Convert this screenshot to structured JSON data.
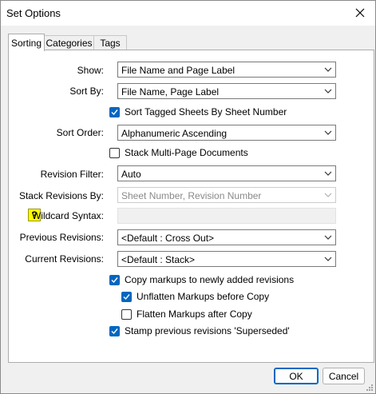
{
  "window": {
    "title": "Set Options"
  },
  "tabs": [
    {
      "label": "Sorting"
    },
    {
      "label": "Categories"
    },
    {
      "label": "Tags"
    }
  ],
  "fields": {
    "show": {
      "label": "Show:",
      "value": "File Name and Page Label"
    },
    "sort_by": {
      "label": "Sort By:",
      "value": "File Name, Page Label"
    },
    "sort_tagged": {
      "label": "Sort Tagged Sheets By Sheet Number",
      "checked": true
    },
    "sort_order": {
      "label": "Sort Order:",
      "value": "Alphanumeric Ascending"
    },
    "stack_multi": {
      "label": "Stack Multi-Page Documents",
      "checked": false
    },
    "revision_filter": {
      "label": "Revision Filter:",
      "value": "Auto"
    },
    "stack_revisions": {
      "label": "Stack Revisions By:",
      "value": "Sheet Number, Revision Number",
      "disabled": true
    },
    "wildcard": {
      "help": "?",
      "label": "Wildcard Syntax:",
      "value": ""
    },
    "previous_revisions": {
      "label": "Previous Revisions:",
      "value": "<Default : Cross Out>"
    },
    "current_revisions": {
      "label": "Current Revisions:",
      "value": "<Default : Stack>"
    },
    "copy_markups": {
      "label": "Copy markups to newly added revisions",
      "checked": true
    },
    "unflatten": {
      "label": "Unflatten Markups before Copy",
      "checked": true
    },
    "flatten": {
      "label": "Flatten Markups after Copy",
      "checked": false
    },
    "stamp": {
      "label": "Stamp previous revisions 'Superseded'",
      "checked": true
    }
  },
  "buttons": {
    "ok": "OK",
    "cancel": "Cancel"
  },
  "colors": {
    "accent": "#0067c0",
    "help_bg": "#ffff00"
  }
}
